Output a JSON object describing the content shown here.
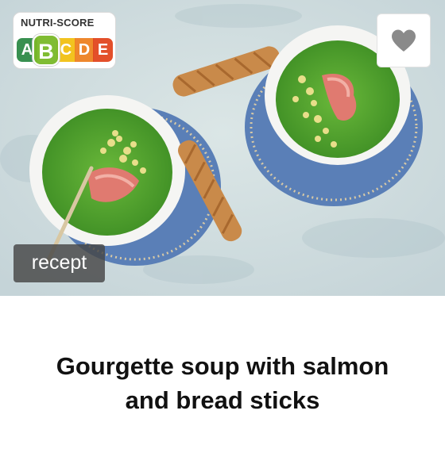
{
  "card": {
    "title": "Gourgette soup with salmon and bread sticks",
    "category_label": "recept"
  },
  "nutri_score": {
    "label": "NUTRI-SCORE",
    "grades": [
      "A",
      "B",
      "C",
      "D",
      "E"
    ],
    "selected": "B",
    "colors": {
      "A": "#2e8b47",
      "B": "#7ab929",
      "C": "#f2c014",
      "D": "#ee8122",
      "E": "#e2461f"
    }
  },
  "favorite": {
    "icon": "heart-icon",
    "color": "#8a8a8a"
  },
  "photo": {
    "description_icon": "recipe-photo"
  }
}
